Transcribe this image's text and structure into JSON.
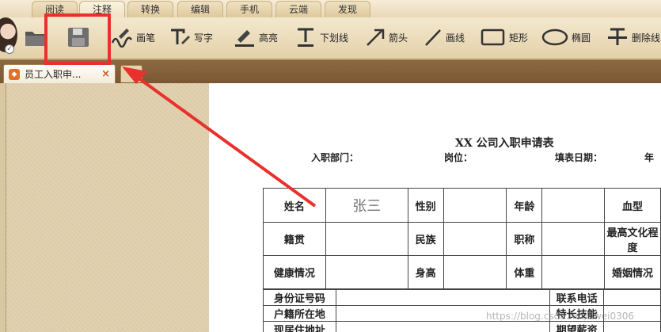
{
  "menu": {
    "tabs": [
      "阅读",
      "注释",
      "转换",
      "编辑",
      "手机",
      "云端",
      "发现"
    ],
    "active_index": 1
  },
  "toolbar": {
    "buttons": [
      {
        "icon": "folder-icon",
        "label": ""
      },
      {
        "icon": "save-icon",
        "label": ""
      },
      {
        "icon": "pen-icon",
        "label": "画笔"
      },
      {
        "icon": "text-icon",
        "label": "写字"
      },
      {
        "icon": "highlight-icon",
        "label": "高亮"
      },
      {
        "icon": "underline-icon",
        "label": "下划线"
      },
      {
        "icon": "arrow-icon",
        "label": "箭头"
      },
      {
        "icon": "line-icon",
        "label": "画线"
      },
      {
        "icon": "rectangle-icon",
        "label": "矩形"
      },
      {
        "icon": "ellipse-icon",
        "label": "椭圆"
      },
      {
        "icon": "strikethrough-icon",
        "label": "删除线"
      }
    ]
  },
  "tabs": {
    "document_tab_label": "员工入职申...",
    "close_symbol": "×"
  },
  "document": {
    "title": "XX 公司入职申请表",
    "meta": {
      "department": "入职部门：",
      "position": "岗位：",
      "date": "填表日期：",
      "year": "年"
    },
    "rows": {
      "name_label": "姓名",
      "name_value": "张三",
      "gender_label": "性别",
      "age_label": "年龄",
      "blood_label": "血型",
      "origin_label": "籍贯",
      "ethnicity_label": "民族",
      "title_label": "职称",
      "education_label": "最高文化程度",
      "health_label": "健康情况",
      "height_label": "身高",
      "weight_label": "体重",
      "marital_label": "婚姻情况",
      "id_label": "身份证号码",
      "phone_label": "联系电话",
      "hukou_label": "户籍所在地",
      "skill_label": "特长技能",
      "address_label": "现居住地址",
      "salary_label": "期望薪资"
    }
  },
  "watermark": "https://blog.csdn.net/dwei0306",
  "colors": {
    "annotation_red": "#e8302c"
  }
}
